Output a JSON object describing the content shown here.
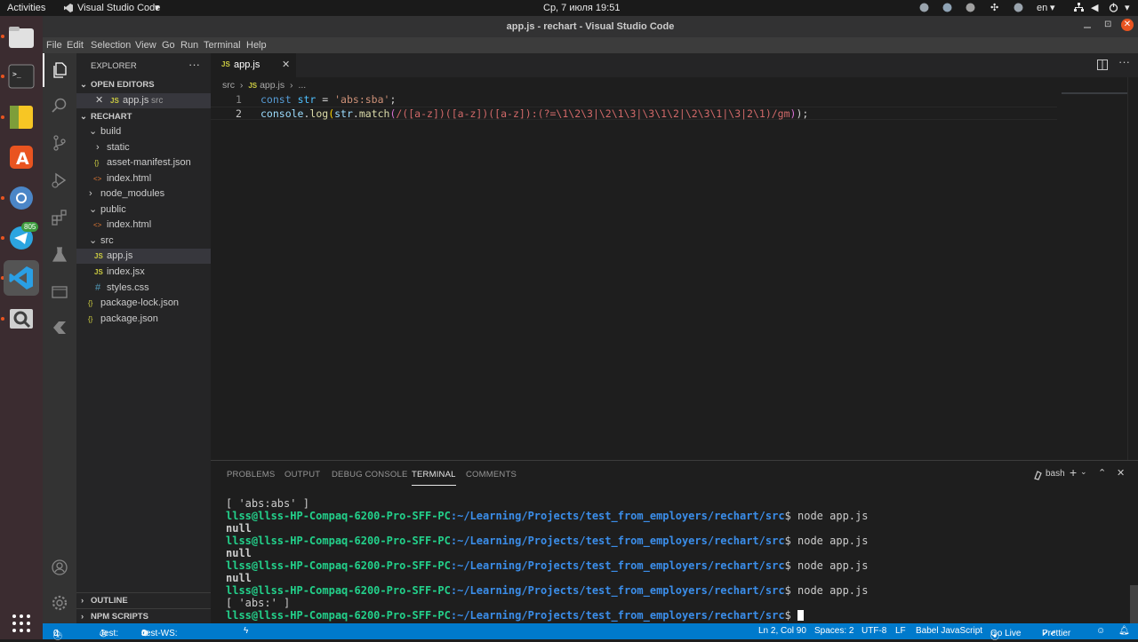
{
  "topbar": {
    "activities": "Activities",
    "app_name": "Visual Studio Code",
    "clock": "Ср, 7 июля  19:51",
    "lang": "en"
  },
  "dock": {
    "telegram_badge": "805"
  },
  "window": {
    "title": "app.js - rechart - Visual Studio Code"
  },
  "menu": [
    "File",
    "Edit",
    "Selection",
    "View",
    "Go",
    "Run",
    "Terminal",
    "Help"
  ],
  "explorer": {
    "header": "EXPLORER",
    "open_editors_label": "OPEN EDITORS",
    "open_file_icon": "JS",
    "open_file_name": "app.js",
    "open_file_dir": "src",
    "project": "RECHART",
    "items": [
      {
        "label": "build"
      },
      {
        "label": "static"
      },
      {
        "label": "asset-manifest.json",
        "icon": "{}"
      },
      {
        "label": "index.html",
        "icon": "<>"
      },
      {
        "label": "node_modules"
      },
      {
        "label": "public"
      },
      {
        "label": "index.html",
        "icon": "<>"
      },
      {
        "label": "src"
      },
      {
        "label": "app.js",
        "icon": "JS"
      },
      {
        "label": "index.jsx",
        "icon": "JS"
      },
      {
        "label": "styles.css",
        "icon": "#"
      },
      {
        "label": "package-lock.json",
        "icon": "{}"
      },
      {
        "label": "package.json",
        "icon": "{}"
      }
    ],
    "outline": "OUTLINE",
    "npm_scripts": "NPM SCRIPTS"
  },
  "editor": {
    "tab_icon": "JS",
    "tab_label": "app.js",
    "breadcrumb": [
      "src",
      "JS",
      "app.js",
      "..."
    ],
    "line_numbers": [
      "1",
      "2"
    ],
    "line1": {
      "kw": "const",
      "name": "str",
      "eq": " = ",
      "str": "'abs:sba'",
      "end": ";"
    },
    "line2": {
      "obj": "console",
      "fn1": "log",
      "arg": "str",
      "fn2": "match",
      "regex": "/([a-z])([a-z])([a-z]):(?=\\1\\2\\3|\\2\\1\\3|\\3\\1\\2|\\2\\3\\1|\\3|2\\1)/gm",
      "end": ");"
    }
  },
  "panel": {
    "tabs": [
      "PROBLEMS",
      "OUTPUT",
      "DEBUG CONSOLE",
      "TERMINAL",
      "COMMENTS"
    ],
    "shell": "bash",
    "prompt": "llss@llss-HP-Compaq-6200-Pro-SFF-PC",
    "path": ":~/Learning/Projects/test_from_employers/rechart/src",
    "command": "$ node app.js",
    "last_prompt_suffix": "$ ",
    "outputs": {
      "first": "[ 'abs:abs' ]",
      "null": "null",
      "last": "[ 'abs:' ]"
    }
  },
  "status": {
    "errors": "0",
    "warnings": "0",
    "jest": "Jest:",
    "jest_ws": "Jest-WS:",
    "jest_counts": [
      "0",
      "0",
      "0"
    ],
    "position": "Ln 2, Col 90",
    "spaces": "Spaces: 2",
    "encoding": "UTF-8",
    "eol": "LF",
    "language": "Babel JavaScript",
    "golive": "Go Live",
    "prettier": "Prettier"
  },
  "colors": {
    "keyword": "#569cd6",
    "variable": "#9cdcfe",
    "function": "#dcdcaa",
    "string": "#ce9178",
    "regex": "#d16969",
    "prompt_green": "#23d18b",
    "path_blue": "#3b8eea",
    "status_bg": "#007acc"
  }
}
